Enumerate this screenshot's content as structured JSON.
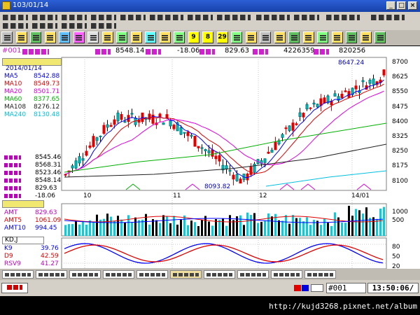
{
  "window": {
    "title_prefix": "",
    "title_code": "103/01/14",
    "icon": "app-logo-icon",
    "controls": [
      "minimize-icon",
      "maximize-icon",
      "close-icon"
    ]
  },
  "toolbar": {
    "numbers": [
      "9",
      "8",
      "29"
    ],
    "colors": [
      "#c0c0c0",
      "#ffe060",
      "#60c060",
      "#ffe060",
      "#60c0ff",
      "#ff60ff",
      "#e0e0e0",
      "#ffe060",
      "#80ff80",
      "#ffe060",
      "#60ffff",
      "#ffe060",
      "#80ff80",
      "#ffff00",
      "#ffff00",
      "#ffff00",
      "#80ff80",
      "#ffe060",
      "#c0c0c0",
      "#ffe060",
      "#60c060",
      "#ffe060",
      "#80ff80",
      "#ffe060",
      "#60c060",
      "#ffe060",
      "#60c060"
    ]
  },
  "info": {
    "code": "#001",
    "index_value": "8548.14",
    "change_value": "-18.06",
    "amount_value": "829.63",
    "volume_value": "4226359",
    "count_value": "820256"
  },
  "price_panel": {
    "date": "2014/01/14",
    "ma": [
      {
        "name": "MA5",
        "value": "8542.88",
        "color": "#0000ff"
      },
      {
        "name": "MA10",
        "value": "8549.73",
        "color": "#e00000"
      },
      {
        "name": "MA20",
        "value": "8501.71",
        "color": "#e000e0"
      },
      {
        "name": "MA60",
        "value": "8377.65",
        "color": "#00b000"
      },
      {
        "name": "MA108",
        "value": "8276.12",
        "color": "#202020"
      },
      {
        "name": "MA240",
        "value": "8130.48",
        "color": "#00c0e0"
      }
    ],
    "ohlc": [
      {
        "value": "8545.46"
      },
      {
        "value": "8568.31"
      },
      {
        "value": "8523.46"
      },
      {
        "value": "8548.14"
      },
      {
        "value": "829.63"
      },
      {
        "value": "-18.06"
      }
    ],
    "high_marker": "8647.24",
    "low_marker": "8093.82",
    "axis": [
      "8700",
      "8625",
      "8550",
      "8475",
      "8400",
      "8325",
      "8250",
      "8175",
      "8100"
    ],
    "months": [
      "10",
      "11",
      "12",
      "14/01"
    ]
  },
  "amount_panel": {
    "series": [
      {
        "name": "AMT",
        "value": "829.63",
        "color": "#c000c0"
      },
      {
        "name": "AMT5",
        "value": "1061.09",
        "color": "#e00000"
      },
      {
        "name": "AMT10",
        "value": "994.45",
        "color": "#0000ff"
      }
    ],
    "axis": [
      "1000",
      "500"
    ]
  },
  "kd_panel": {
    "title": "KD,J",
    "series": [
      {
        "name": "K9",
        "value": "39.76",
        "color": "#0000ff"
      },
      {
        "name": "D9",
        "value": "42.59",
        "color": "#e00000"
      },
      {
        "name": "RSV9",
        "value": "41.27",
        "color": "#c000c0"
      }
    ],
    "axis": [
      "80",
      "50",
      "20"
    ]
  },
  "tabs": {
    "count": 10,
    "active": 5
  },
  "status": {
    "symbol": "#001",
    "time": "13:50:06/"
  },
  "footer": {
    "url": "http://kujd3268.pixnet.net/album"
  }
}
